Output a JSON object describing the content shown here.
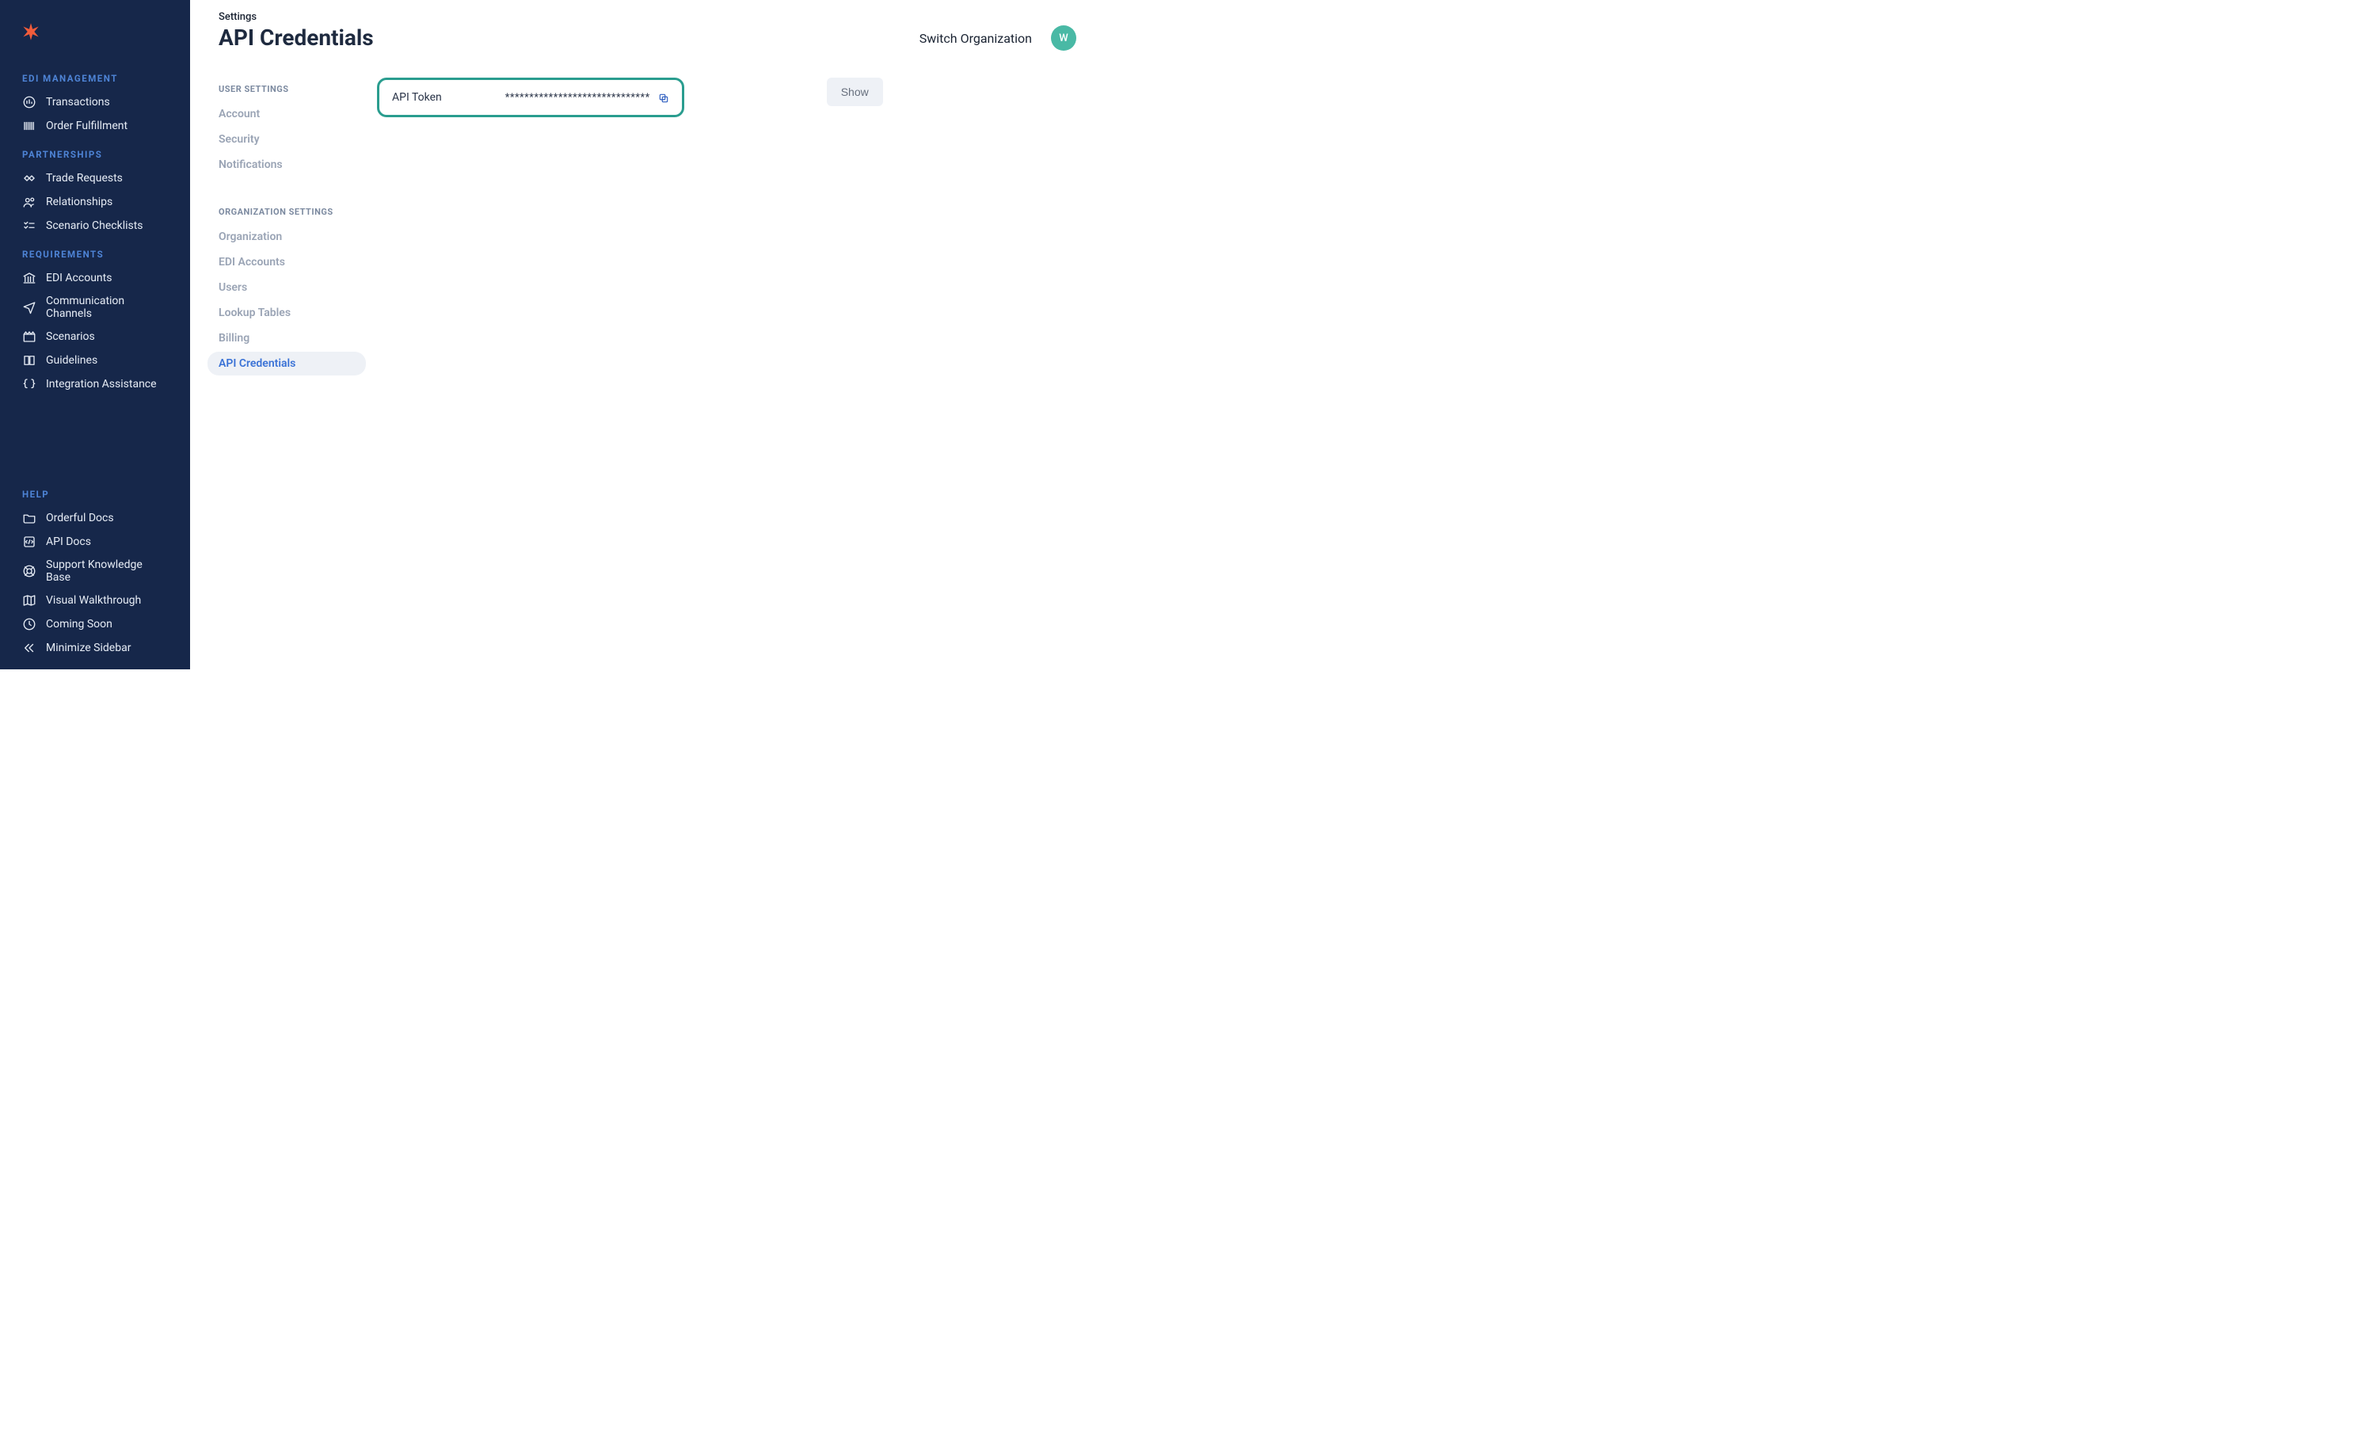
{
  "sidebar": {
    "sections": [
      {
        "title": "EDI MANAGEMENT",
        "items": [
          {
            "label": "Transactions",
            "icon": "chart-circle-icon"
          },
          {
            "label": "Order Fulfillment",
            "icon": "barcode-icon"
          }
        ]
      },
      {
        "title": "PARTNERSHIPS",
        "items": [
          {
            "label": "Trade Requests",
            "icon": "handshake-icon"
          },
          {
            "label": "Relationships",
            "icon": "users-icon"
          },
          {
            "label": "Scenario Checklists",
            "icon": "checklist-icon"
          }
        ]
      },
      {
        "title": "REQUIREMENTS",
        "items": [
          {
            "label": "EDI Accounts",
            "icon": "bank-icon"
          },
          {
            "label": "Communication Channels",
            "icon": "send-icon"
          },
          {
            "label": "Scenarios",
            "icon": "clapper-icon"
          },
          {
            "label": "Guidelines",
            "icon": "book-icon"
          },
          {
            "label": "Integration Assistance",
            "icon": "braces-icon"
          }
        ]
      }
    ],
    "help": {
      "title": "HELP",
      "items": [
        {
          "label": "Orderful Docs",
          "icon": "folder-icon"
        },
        {
          "label": "API Docs",
          "icon": "api-doc-icon"
        },
        {
          "label": "Support Knowledge Base",
          "icon": "life-ring-icon"
        },
        {
          "label": "Visual Walkthrough",
          "icon": "map-icon"
        },
        {
          "label": "Coming Soon",
          "icon": "clock-icon"
        },
        {
          "label": "Minimize Sidebar",
          "icon": "chevrons-left-icon"
        }
      ]
    }
  },
  "header": {
    "breadcrumb": "Settings",
    "title": "API Credentials",
    "switch_org": "Switch Organization",
    "avatar_initial": "W"
  },
  "settings_nav": {
    "user_section": "USER SETTINGS",
    "user_items": [
      "Account",
      "Security",
      "Notifications"
    ],
    "org_section": "ORGANIZATION SETTINGS",
    "org_items": [
      "Organization",
      "EDI Accounts",
      "Users",
      "Lookup Tables",
      "Billing",
      "API Credentials"
    ],
    "active": "API Credentials"
  },
  "api_panel": {
    "label": "API Token",
    "masked_value": "******************************",
    "show_label": "Show"
  },
  "colors": {
    "sidebar_bg": "#16274a",
    "accent_blue": "#4e84d6",
    "highlight_teal": "#2a9d8f",
    "logo_orange": "#f25c3b"
  }
}
